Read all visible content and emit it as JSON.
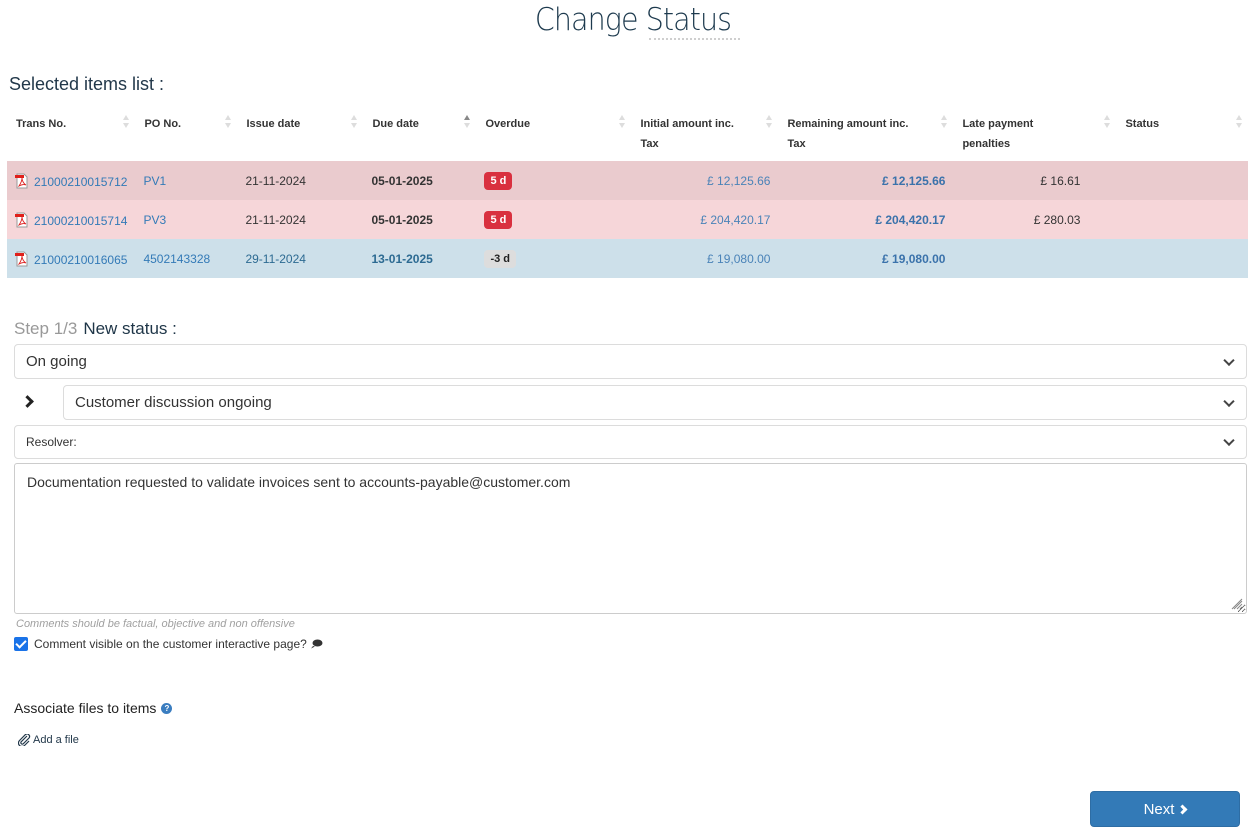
{
  "page": {
    "title": "Change Status"
  },
  "selected_items": {
    "title": "Selected items list :",
    "columns": [
      {
        "label": "Trans No.",
        "sort": "none"
      },
      {
        "label": "PO No.",
        "sort": "none"
      },
      {
        "label": "Issue date",
        "sort": "none"
      },
      {
        "label": "Due date",
        "sort": "asc"
      },
      {
        "label": "Overdue",
        "sort": "none"
      },
      {
        "label": "Initial amount inc. Tax",
        "sort": "none"
      },
      {
        "label": "Remaining amount inc. Tax",
        "sort": "none"
      },
      {
        "label": "Late payment penalties",
        "sort": "none"
      },
      {
        "label": "Status",
        "sort": "none"
      }
    ],
    "rows": [
      {
        "trans_no": "21000210015712",
        "po_no": "PV1",
        "issue_date": "21-11-2024",
        "due_date": "05-01-2025",
        "overdue": "5 d",
        "overdue_type": "late",
        "initial_amount": "£ 12,125.66",
        "remaining_amount": "£ 12,125.66",
        "late_penalties": "£ 16.61",
        "status": "",
        "row_color": "#eacbce"
      },
      {
        "trans_no": "21000210015714",
        "po_no": "PV3",
        "issue_date": "21-11-2024",
        "due_date": "05-01-2025",
        "overdue": "5 d",
        "overdue_type": "late",
        "initial_amount": "£ 204,420.17",
        "remaining_amount": "£ 204,420.17",
        "late_penalties": "£ 280.03",
        "status": "",
        "row_color": "#f6d6d9"
      },
      {
        "trans_no": "21000210016065",
        "po_no": "4502143328",
        "issue_date": "29-11-2024",
        "due_date": "13-01-2025",
        "overdue": "-3 d",
        "overdue_type": "not_due",
        "initial_amount": "£ 19,080.00",
        "remaining_amount": "£ 19,080.00",
        "late_penalties": "",
        "status": "",
        "row_color": "#cde0ea"
      }
    ]
  },
  "form": {
    "step": "Step 1/3",
    "step_title": "New status :",
    "status_select": {
      "value": "On going"
    },
    "substatus_select": {
      "value": "Customer discussion ongoing"
    },
    "resolver_select": {
      "value": "Resolver:"
    },
    "comment": {
      "value": "Documentation requested to validate invoices sent to accounts-payable@customer.com",
      "hint": "Comments should be factual, objective and non offensive"
    },
    "visible_checkbox": {
      "label": "Comment visible on the customer interactive page?",
      "checked": true
    },
    "associate_files": {
      "label": "Associate files to items",
      "help_icon": "question-circle-icon"
    },
    "add_file": {
      "label": "Add a file",
      "icon": "paperclip-icon"
    },
    "next_button": {
      "label": "Next"
    }
  },
  "colors": {
    "accent": "#337ab7",
    "overdue_badge": "#d9303f",
    "row_overdue_1": "#eacbce",
    "row_overdue_2": "#f6d6d9",
    "row_not_due": "#cde0ea"
  }
}
